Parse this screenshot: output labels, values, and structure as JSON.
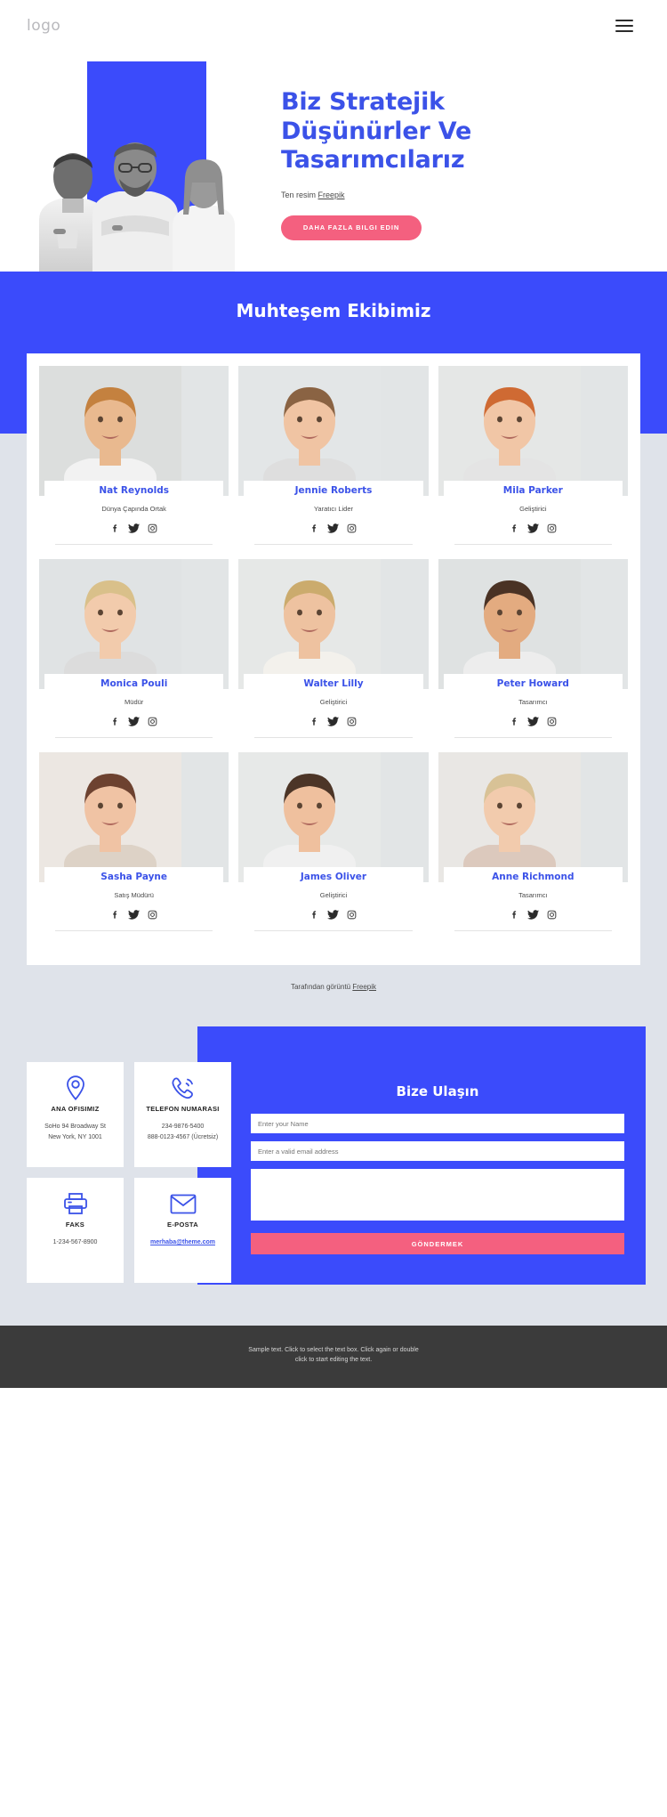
{
  "header": {
    "logo": "logo",
    "menu_icon": "hamburger-icon"
  },
  "hero": {
    "title_line1": "Biz Stratejik",
    "title_line2": "Düşünürler Ve",
    "title_line3": "Tasarımcılarız",
    "credit_prefix": "Ten resim ",
    "credit_link": "Freepik",
    "cta_label": "DAHA FAZLA BILGI EDIN"
  },
  "team": {
    "title": "Muhteşem Ekibimiz",
    "credit_prefix": "Tarafından görüntü ",
    "credit_link": "Freepik",
    "social": [
      "facebook-icon",
      "twitter-icon",
      "instagram-icon"
    ],
    "members": [
      {
        "name": "Nat Reynolds",
        "role": "Dünya Çapında Ortak"
      },
      {
        "name": "Jennie Roberts",
        "role": "Yaratıcı Lider"
      },
      {
        "name": "Mila Parker",
        "role": "Geliştirici"
      },
      {
        "name": "Monica Pouli",
        "role": "Müdür"
      },
      {
        "name": "Walter Lilly",
        "role": "Geliştirici"
      },
      {
        "name": "Peter Howard",
        "role": "Tasarımcı"
      },
      {
        "name": "Sasha Payne",
        "role": "Satış Müdürü"
      },
      {
        "name": "James Oliver",
        "role": "Geliştirici"
      },
      {
        "name": "Anne Richmond",
        "role": "Tasarımcı"
      }
    ]
  },
  "contact": {
    "cards": [
      {
        "icon": "location-pin-icon",
        "title": "ANA OFISIMIZ",
        "lines": [
          "SoHo 94 Broadway St",
          "New York, NY 1001"
        ]
      },
      {
        "icon": "phone-icon",
        "title": "TELEFON NUMARASI",
        "lines": [
          "234-9876-5400",
          "888-0123-4567 (Ücretsiz)"
        ]
      },
      {
        "icon": "fax-printer-icon",
        "title": "FAKS",
        "lines": [
          "1-234-567-8900"
        ]
      },
      {
        "icon": "envelope-icon",
        "title": "E-POSTA",
        "lines": [],
        "link": "merhaba@theme.com"
      }
    ],
    "form": {
      "title": "Bize Ulaşın",
      "name_placeholder": "Enter your Name",
      "email_placeholder": "Enter a valid email address",
      "message_placeholder": "",
      "submit_label": "GÖNDERMEK"
    }
  },
  "footer": {
    "line1": "Sample text. Click to select the text box. Click again or double",
    "line2": "click to start editing the text."
  },
  "colors": {
    "brand_blue": "#3b4bfb",
    "text_blue": "#3b52e8",
    "accent_pink": "#f4607f",
    "page_grey": "#dfe3ea",
    "footer_dark": "#3b3b3b"
  }
}
